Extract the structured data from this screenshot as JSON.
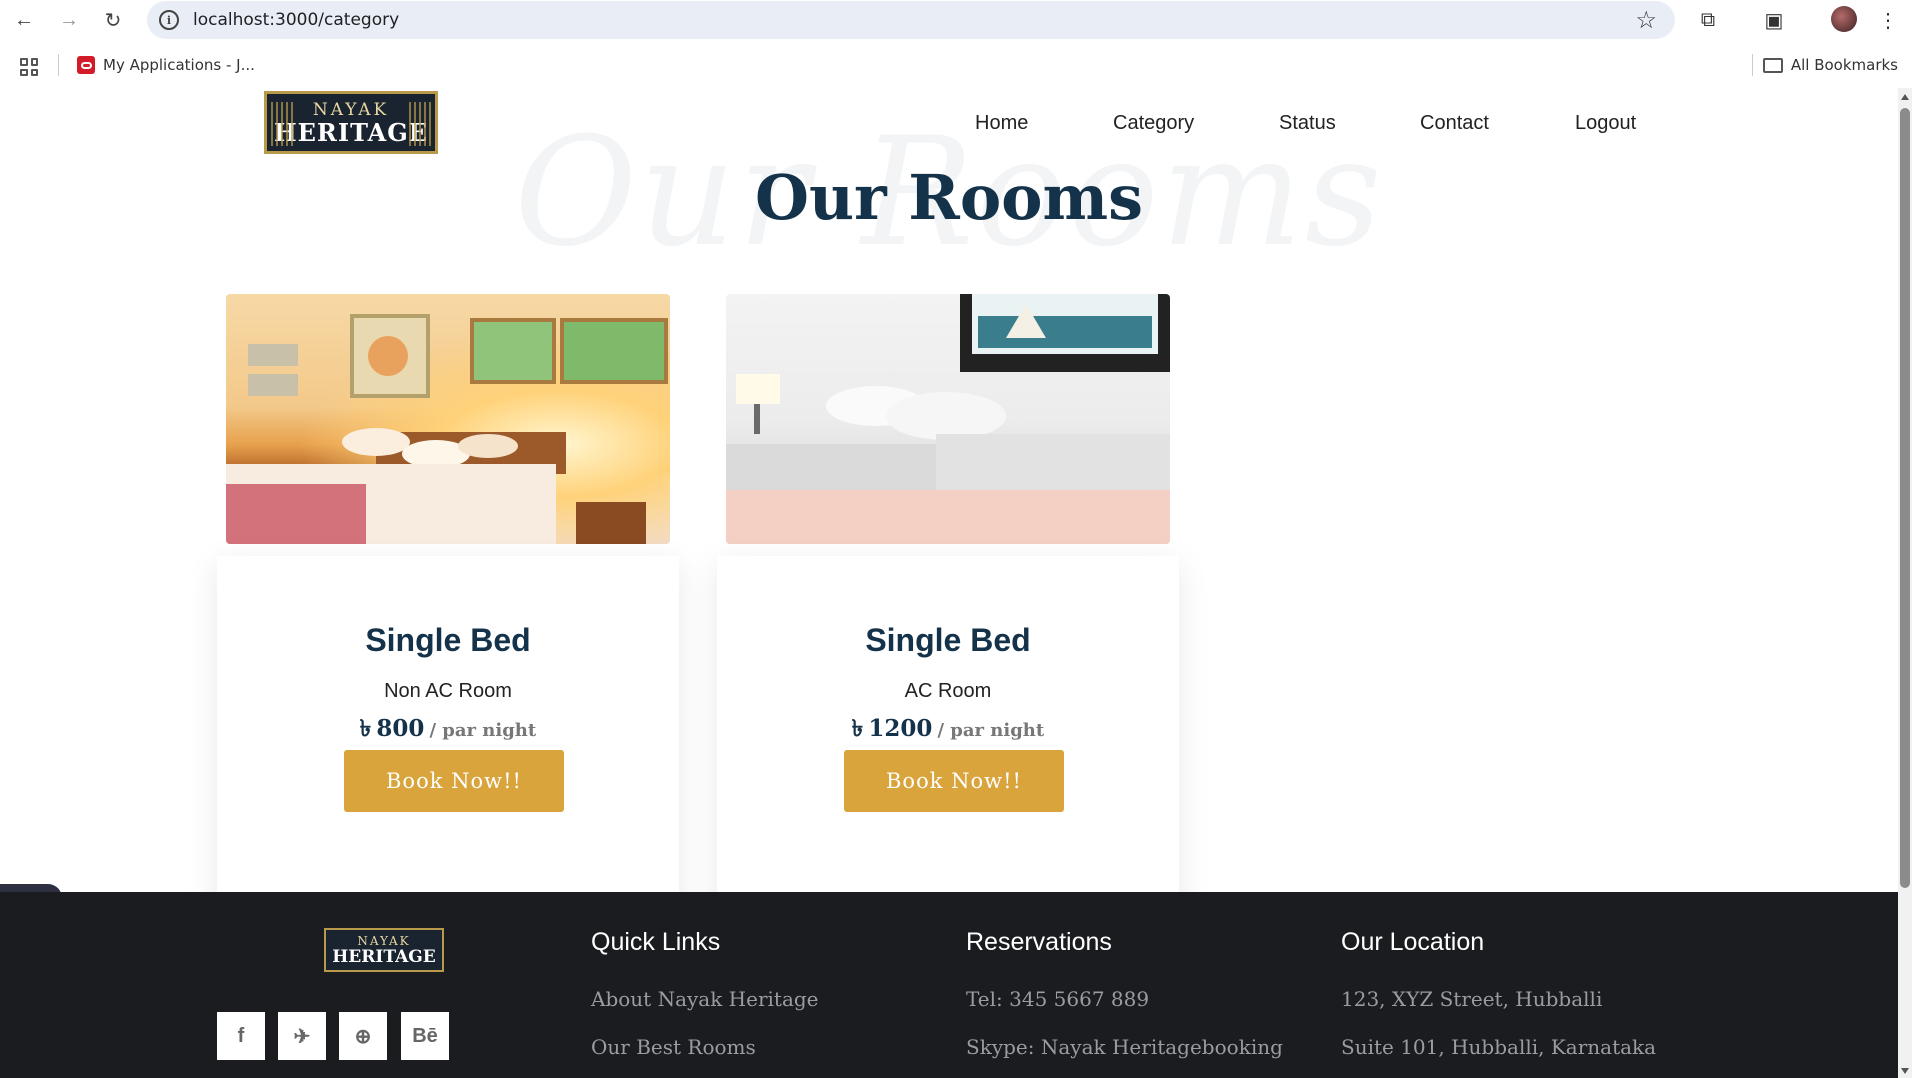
{
  "browser": {
    "url": "localhost:3000/category",
    "bookmark_label": "My Applications - J...",
    "all_bookmarks_label": "All Bookmarks"
  },
  "site": {
    "logo_line1": "NAYAK",
    "logo_line2": "HERITAGE",
    "nav": [
      "Home",
      "Category",
      "Status",
      "Contact",
      "Logout"
    ]
  },
  "main": {
    "ghost_title": "Our Rooms",
    "title": "Our Rooms",
    "rooms": [
      {
        "name": "Single Bed",
        "type": "Non AC Room",
        "currency": "৳",
        "price": "800",
        "unit": "/ par night",
        "button": "Book Now!!"
      },
      {
        "name": "Single Bed",
        "type": "AC Room",
        "currency": "৳",
        "price": "1200",
        "unit": "/ par night",
        "button": "Book Now!!"
      }
    ]
  },
  "footer": {
    "logo_line1": "NAYAK",
    "logo_line2": "HERITAGE",
    "social": [
      "facebook-icon",
      "twitter-icon",
      "globe-icon",
      "behance-icon"
    ],
    "social_glyphs": [
      "f",
      "✈",
      "⊕",
      "Bē"
    ],
    "quick_links": {
      "title": "Quick Links",
      "items": [
        "About Nayak Heritage",
        "Our Best Rooms"
      ]
    },
    "reservations": {
      "title": "Reservations",
      "items": [
        "Tel: 345 5667 889",
        "Skype: Nayak Heritagebooking"
      ]
    },
    "location": {
      "title": "Our Location",
      "items": [
        "123, XYZ Street, Hubballi",
        "Suite 101, Hubballi, Karnataka"
      ]
    }
  },
  "colors": {
    "accent": "#d9a43c",
    "title": "#14324a",
    "footer_bg": "#1b1c20"
  }
}
